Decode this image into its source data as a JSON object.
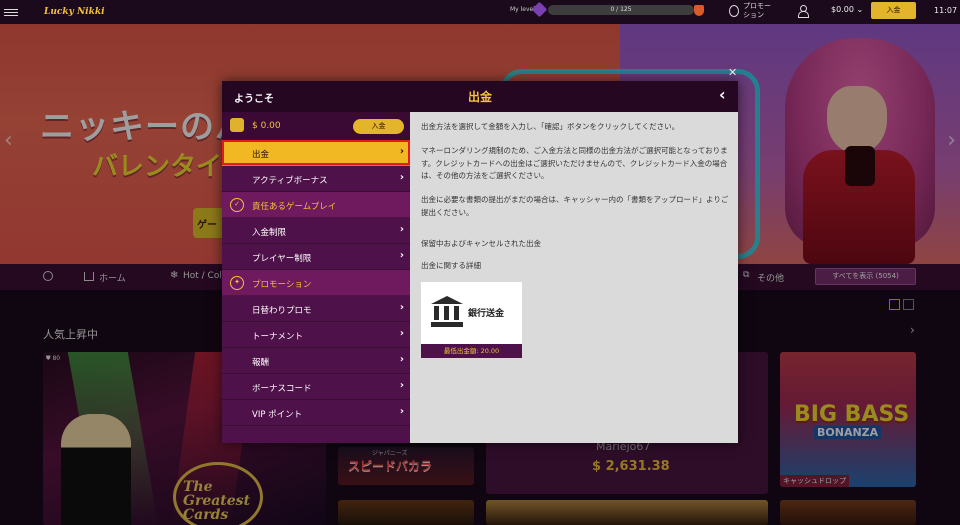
{
  "topbar": {
    "logo": "Lucky Nikki",
    "my_level_label": "My level",
    "level_progress": "0 / 125",
    "level_progress_fraction": 0,
    "promotion_label": "プロモー\nション",
    "balance": "$0.00",
    "deposit_label": "入金",
    "clock": "11:07"
  },
  "banner": {
    "title_line1": "ニッキーのバ",
    "title_line2": "バレンタイ",
    "button_fragment": "ゲー"
  },
  "nav": {
    "home": "ホーム",
    "hot": "Hot / Cold",
    "other": "その他",
    "show_all": "すべてを表示 (5054)"
  },
  "section": {
    "title": "人気上昇中"
  },
  "tiles": {
    "big_viewers": "80",
    "big_logo": "The Greatest Cards",
    "baccarat_sub": "ジャパニーズ",
    "baccarat": "スピードバカラ",
    "mari_name": "Mariejo67",
    "mari_amount": "$ 2,631.38",
    "bigbass_line1": "BIG BASS",
    "bigbass_line2": "BONANZA",
    "bigbass_tag": "キャッシュドロップ"
  },
  "modal": {
    "welcome": "ようこそ",
    "title": "出金",
    "wallet_amount": "$ 0.00",
    "wallet_deposit": "入金",
    "menu": [
      {
        "label": "出金",
        "active": true
      },
      {
        "label": "アクティブボーナス"
      },
      {
        "label": "責任あるゲームプレイ",
        "section": true
      },
      {
        "label": "入金制限"
      },
      {
        "label": "プレイヤー制限"
      },
      {
        "label": "プロモーション",
        "section": true
      },
      {
        "label": "日替わりプロモ"
      },
      {
        "label": "トーナメント"
      },
      {
        "label": "報酬"
      },
      {
        "label": "ボーナスコード"
      },
      {
        "label": "VIP ポイント"
      }
    ],
    "content": {
      "p1": "出金方法を選択して金額を入力し、「確認」ボタンをクリックしてください。",
      "p2": "マネーロンダリング規制のため、ご入金方法と同様の出金方法がご選択可能となっております。クレジットカードへの出金はご選択いただけませんので、クレジットカード入金の場合は、その他の方法をご選択ください。",
      "p3": "出金に必要な書類の提出がまだの場合は、キャッシャー内の「書類をアップロード」よりご提出ください。",
      "p4": "保留中およびキャンセルされた出金",
      "p5": "出金に関する詳細",
      "bank_name": "銀行送金",
      "bank_min": "最低出金額: 20.00"
    }
  },
  "colors": {
    "accent": "#f2c23a",
    "menu_bg": "#4f1149",
    "header_bg": "#250722",
    "active_outline": "#e21c1c"
  }
}
